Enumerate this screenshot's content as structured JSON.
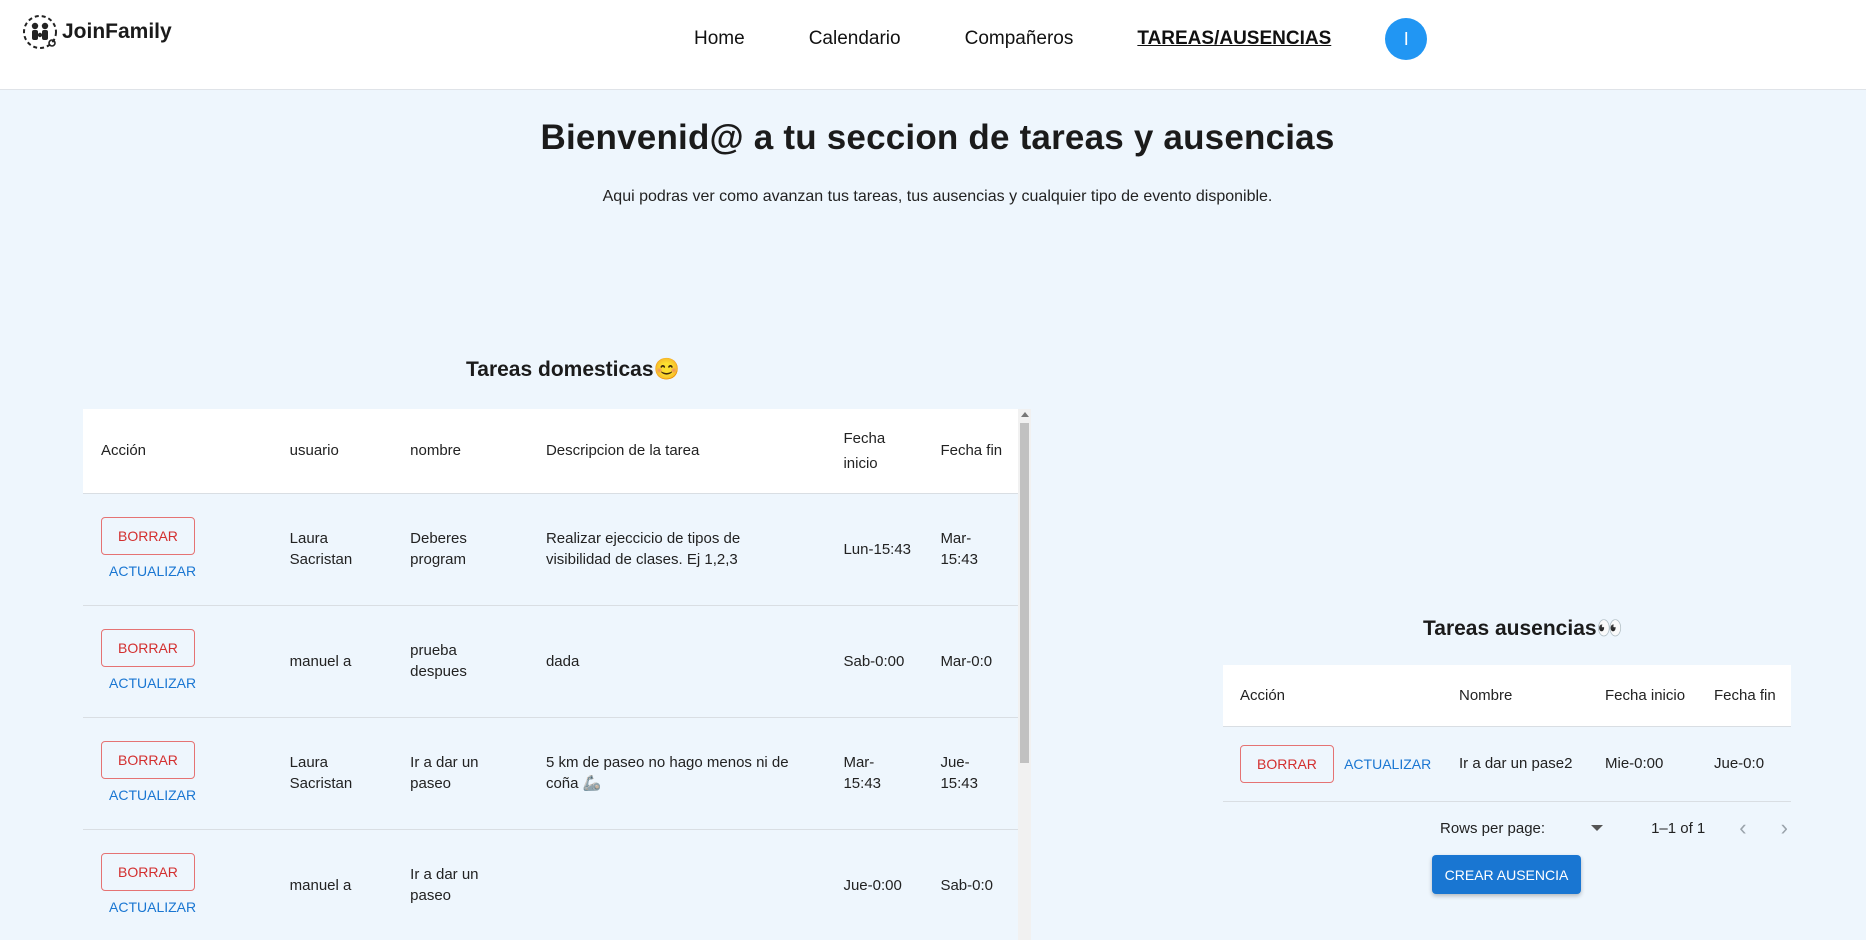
{
  "app": {
    "logo_text": "JoinFamily"
  },
  "nav": {
    "items": [
      "Home",
      "Calendario",
      "Compañeros",
      "TAREAS/AUSENCIAS"
    ],
    "active": "TAREAS/AUSENCIAS",
    "avatar_letter": "I"
  },
  "hero": {
    "title": "Bienvenid@ a tu seccion de tareas y ausencias",
    "subtitle": "Aqui podras ver como avanzan tus tareas, tus ausencias y cualquier tipo de evento disponible."
  },
  "domesticas": {
    "title": "Tareas domesticas😊",
    "columns": [
      "Acción",
      "usuario",
      "nombre",
      "Descripcion de la tarea",
      "Fecha inicio",
      "Fecha fin"
    ],
    "rows": [
      {
        "borrar": "BORRAR",
        "actualizar": "ACTUALIZAR",
        "usuario": "Laura Sacristan",
        "nombre": "Deberes program",
        "descripcion": "Realizar ejeccicio de tipos de visibilidad de clases. Ej 1,2,3",
        "inicio": "Lun-15:43",
        "fin": "Mar-15:43"
      },
      {
        "borrar": "BORRAR",
        "actualizar": "ACTUALIZAR",
        "usuario": "manuel a",
        "nombre": "prueba despues",
        "descripcion": "dada",
        "inicio": "Sab-0:00",
        "fin": "Mar-0:0"
      },
      {
        "borrar": "BORRAR",
        "actualizar": "ACTUALIZAR",
        "usuario": "Laura Sacristan",
        "nombre": "Ir a dar un paseo",
        "descripcion": "5 km de paseo no hago menos ni de coña 🦾",
        "inicio": "Mar-15:43",
        "fin": "Jue-15:43"
      },
      {
        "borrar": "BORRAR",
        "actualizar": "ACTUALIZAR",
        "usuario": "manuel a",
        "nombre": "Ir a dar un paseo",
        "descripcion": "",
        "inicio": "Jue-0:00",
        "fin": "Sab-0:0"
      }
    ]
  },
  "ausencias": {
    "title": "Tareas ausencias👀",
    "columns": [
      "Acción",
      "Nombre",
      "Fecha inicio",
      "Fecha fin"
    ],
    "rows": [
      {
        "borrar": "BORRAR",
        "actualizar": "ACTUALIZAR",
        "nombre": "Ir a dar un pase2",
        "inicio": "Mie-0:00",
        "fin": "Jue-0:0"
      }
    ],
    "rows_per_page_label": "Rows per page:",
    "range": "1–1 of 1",
    "create_label": "CREAR AUSENCIA"
  },
  "colors": {
    "background": "#eef6fd",
    "primary": "#1976d2",
    "danger": "#d32f2f",
    "avatar": "#2196f3"
  }
}
